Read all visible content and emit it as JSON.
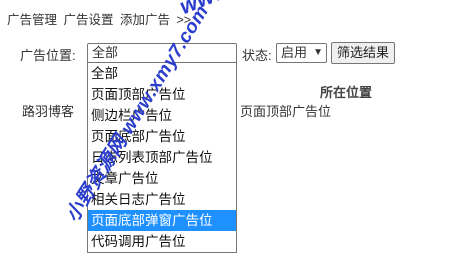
{
  "breadcrumb": [
    "广告管理",
    "广告设置",
    "添加广告",
    ">>"
  ],
  "filter": {
    "position_label": "广告位置:",
    "position_value": "全部",
    "status_label": "状态:",
    "status_value": "启用",
    "button_label": "筛选结果"
  },
  "table": {
    "header_position": "所在位置",
    "row1_name": "路羽博客",
    "row1_position": "页面顶部广告位"
  },
  "dropdown_options": [
    "全部",
    "页面顶部广告位",
    "侧边栏广告位",
    "页面底部广告位",
    "日志列表顶部广告位",
    "文章广告位",
    "相关日志广告位",
    "页面底部弹窗广告位",
    "代码调用广告位"
  ],
  "dropdown_selected_index": 7,
  "watermark": {
    "top": "www.xmy7.com",
    "diagonal": "小野资源网 www.xmy7.com"
  }
}
